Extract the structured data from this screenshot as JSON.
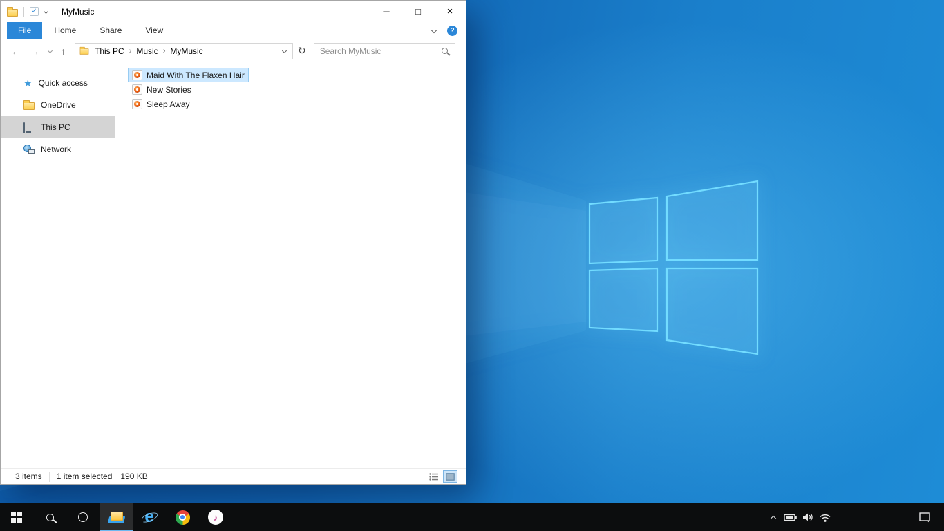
{
  "colors": {
    "accent_blue": "#2b87d8",
    "selection_fill": "#cce8ff",
    "selection_border": "#98ccf2",
    "nav_selected_gray": "#d4d4d4",
    "folder_yellow": "#fcce4e",
    "taskbar_black": "#0c0d0e",
    "wallpaper_dark_blue": "#0d58a4",
    "wallpaper_light_blue": "#1e8cd6",
    "logo_glow_cyan": "#72dcff"
  },
  "explorer": {
    "title": "MyMusic",
    "caption": {
      "minimize": "─",
      "maximize": "□",
      "close": "×"
    },
    "ribbon": {
      "tabs": [
        "File",
        "Home",
        "Share",
        "View"
      ],
      "help_label": "?"
    },
    "navigation": {
      "back": "←",
      "forward": "→",
      "up": "↑",
      "refresh": "↻"
    },
    "breadcrumb": {
      "separator": "›",
      "items": [
        "This PC",
        "Music",
        "MyMusic"
      ]
    },
    "search": {
      "placeholder": "Search MyMusic"
    },
    "sidebar": {
      "items": [
        {
          "label": "Quick access",
          "icon": "quick-access-star",
          "selected": false
        },
        {
          "label": "OneDrive",
          "icon": "onedrive-folder",
          "selected": false
        },
        {
          "label": "This PC",
          "icon": "this-pc-monitor",
          "selected": true
        },
        {
          "label": "Network",
          "icon": "network-globe",
          "selected": false
        }
      ]
    },
    "files": [
      {
        "name": "Maid With The Flaxen Hair",
        "icon": "audio-file",
        "selected": true
      },
      {
        "name": "New Stories",
        "icon": "audio-file",
        "selected": false
      },
      {
        "name": "Sleep Away",
        "icon": "audio-file",
        "selected": false
      }
    ],
    "status": {
      "count": "3 items",
      "selected": "1 item selected",
      "size": "190 KB"
    },
    "view_toggles": [
      {
        "name": "details-view",
        "active": false
      },
      {
        "name": "thumbnails-view",
        "active": true
      }
    ]
  },
  "taskbar": {
    "buttons": [
      {
        "name": "start",
        "icon": "windows-logo",
        "active": false
      },
      {
        "name": "search",
        "icon": "magnifier",
        "active": false
      },
      {
        "name": "cortana",
        "icon": "circle-ring",
        "active": false
      },
      {
        "name": "file-explorer",
        "icon": "folder",
        "active": true
      },
      {
        "name": "edge",
        "icon": "blue-e",
        "active": false
      },
      {
        "name": "chrome",
        "icon": "chrome-wheel",
        "active": false
      },
      {
        "name": "itunes",
        "icon": "music-note",
        "active": false
      }
    ],
    "edge_letter": "e",
    "itunes_note": "♪",
    "tray": [
      {
        "name": "hidden-icons",
        "icon": "chevron-up"
      },
      {
        "name": "battery",
        "icon": "battery"
      },
      {
        "name": "volume",
        "icon": "speaker"
      },
      {
        "name": "network",
        "icon": "wifi"
      }
    ],
    "action_center": {
      "icon": "notification-square"
    }
  },
  "icons": {
    "star": "★"
  }
}
